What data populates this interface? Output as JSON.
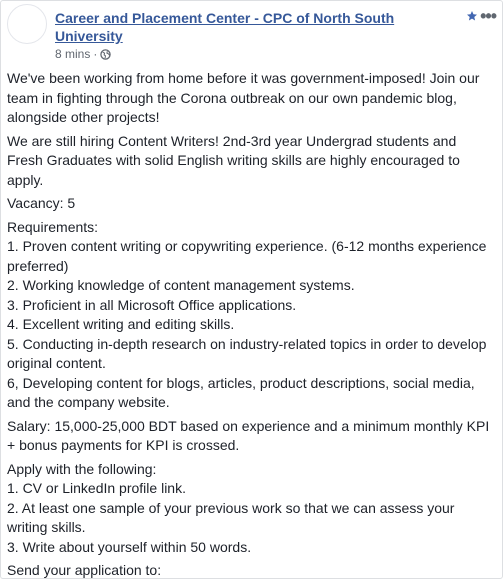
{
  "post": {
    "page_name": "Career and Placement Center - CPC of North South University",
    "time": "8 mins",
    "separator": "·",
    "audience_icon": "globe-icon",
    "favorite_icon": "star-icon",
    "more_label": "•••",
    "paragraphs": [
      [
        "We've been working from home before it was government-imposed! Join our team in fighting through the Corona outbreak on our own pandemic blog, alongside other projects!"
      ],
      [
        "We are still hiring Content Writers! 2nd-3rd year Undergrad students and Fresh Graduates with solid English writing skills are highly encouraged to apply."
      ],
      [
        "Vacancy: 5"
      ],
      [
        "Requirements:",
        "1. Proven content writing or copywriting experience. (6-12 months experience preferred)",
        "2. Working knowledge of content management systems.",
        "3. Proficient in all Microsoft Office applications.",
        "4. Excellent writing and editing skills.",
        "5. Conducting in-depth research on industry-related topics in order to develop original content.",
        "6, Developing content for blogs, articles, product descriptions, social media, and the company website."
      ],
      [
        "Salary: 15,000-25,000 BDT based on experience and a minimum monthly KPI + bonus payments for KPI is crossed."
      ],
      [
        "Apply with the following:",
        "1. CV or LinkedIn profile link.",
        "2. At least one sample of your previous work so that we can assess your writing skills.",
        "3. Write about yourself within 50 words."
      ],
      [
        "Send your application to:"
      ]
    ]
  },
  "colors": {
    "link": "#365899",
    "accent": "#4267b2",
    "text": "#1d2129",
    "meta": "#616770"
  }
}
